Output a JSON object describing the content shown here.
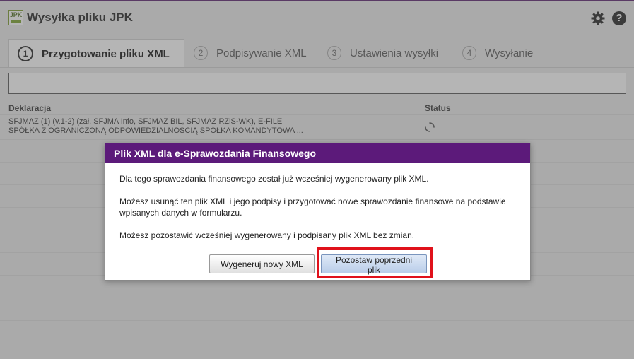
{
  "app": {
    "title": "Wysyłka pliku JPK",
    "logo_text": "JPK",
    "help_label": "?"
  },
  "tabs": [
    {
      "num": "1",
      "label": "Przygotowanie pliku XML",
      "active": true
    },
    {
      "num": "2",
      "label": "Podpisywanie XML",
      "active": false
    },
    {
      "num": "3",
      "label": "Ustawienia wysyłki",
      "active": false
    },
    {
      "num": "4",
      "label": "Wysyłanie",
      "active": false
    }
  ],
  "table": {
    "headers": {
      "declaration": "Deklaracja",
      "status": "Status"
    },
    "rows": [
      {
        "line1": "SFJMAZ (1) (v.1-2) (zał. SFJMA Info, SFJMAZ BIL, SFJMAZ RZiS-WK), E-FILE",
        "line2": "SPÓŁKA Z OGRANICZONĄ ODPOWIEDZIALNOŚCIĄ SPÓŁKA KOMANDYTOWA ...",
        "status_icon": "spinner-icon"
      }
    ]
  },
  "dialog": {
    "title": "Plik XML dla e-Sprawozdania Finansowego",
    "p1": "Dla tego sprawozdania finansowego został już wcześniej wygenerowany plik XML.",
    "p2": "Możesz usunąć ten plik XML i jego podpisy i przygotować nowe sprawozdanie finansowe na podstawie wpisanych danych w formularzu.",
    "p3": "Możesz pozostawić wcześniej wygenerowany i podpisany plik XML bez zmian.",
    "btn_new": "Wygeneruj nowy XML",
    "btn_keep": "Pozostaw poprzedni plik"
  },
  "colors": {
    "accent": "#5c1a7a",
    "highlight": "#e0111b"
  }
}
